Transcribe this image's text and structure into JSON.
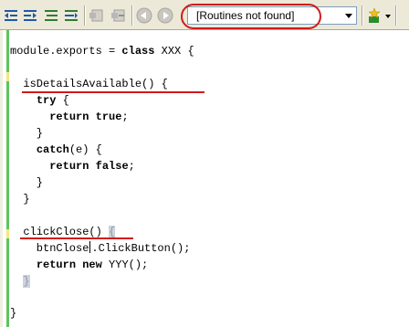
{
  "toolbar": {
    "buttons": [
      {
        "name": "shift-left-icon"
      },
      {
        "name": "shift-right-icon"
      },
      {
        "name": "comment-icon"
      },
      {
        "name": "uncomment-icon"
      },
      {
        "name": "toggle-bookmark-icon"
      },
      {
        "name": "clear-bookmarks-icon"
      },
      {
        "name": "navigate-back-icon"
      },
      {
        "name": "navigate-forward-icon"
      },
      {
        "name": "insert-snippet-icon"
      }
    ],
    "routine_selector": {
      "value": "[Routines not found]"
    }
  },
  "editor": {
    "lines": [
      {
        "tokens": [
          {
            "t": "module.exports = "
          },
          {
            "t": "class",
            "kw": true
          },
          {
            "t": " XXX {"
          }
        ]
      },
      {
        "tokens": [
          {
            "t": "  isDetailsAvailable() {"
          }
        ]
      },
      {
        "tokens": [
          {
            "t": "    "
          },
          {
            "t": "try",
            "kw": true
          },
          {
            "t": " {"
          }
        ]
      },
      {
        "tokens": [
          {
            "t": "      "
          },
          {
            "t": "return",
            "kw": true
          },
          {
            "t": " "
          },
          {
            "t": "true",
            "kw": true
          },
          {
            "t": ";"
          }
        ]
      },
      {
        "tokens": [
          {
            "t": "    }"
          }
        ]
      },
      {
        "tokens": [
          {
            "t": "    "
          },
          {
            "t": "catch",
            "kw": true
          },
          {
            "t": "(e) {"
          }
        ]
      },
      {
        "tokens": [
          {
            "t": "      "
          },
          {
            "t": "return",
            "kw": true
          },
          {
            "t": " "
          },
          {
            "t": "false",
            "kw": true
          },
          {
            "t": ";"
          }
        ]
      },
      {
        "tokens": [
          {
            "t": "    }"
          }
        ]
      },
      {
        "tokens": [
          {
            "t": "  }"
          }
        ]
      },
      {
        "tokens": [
          {
            "t": "  clickClose() "
          },
          {
            "t": "{",
            "hl": true
          }
        ]
      },
      {
        "tokens": [
          {
            "t": "    btnClose"
          },
          {
            "caret": true
          },
          {
            "t": ".ClickButton();"
          }
        ]
      },
      {
        "tokens": [
          {
            "t": "    "
          },
          {
            "t": "return",
            "kw": true
          },
          {
            "t": " "
          },
          {
            "t": "new",
            "kw": true
          },
          {
            "t": " YYY();"
          }
        ]
      },
      {
        "tokens": [
          {
            "t": "  "
          },
          {
            "t": "}",
            "hl": true
          }
        ]
      },
      {
        "tokens": [
          {
            "t": "}"
          }
        ]
      }
    ]
  },
  "colors": {
    "annotation_red": "#d11a1a",
    "toolbar_bg": "#ece9d8",
    "change_bar_green": "#5fc35f"
  }
}
